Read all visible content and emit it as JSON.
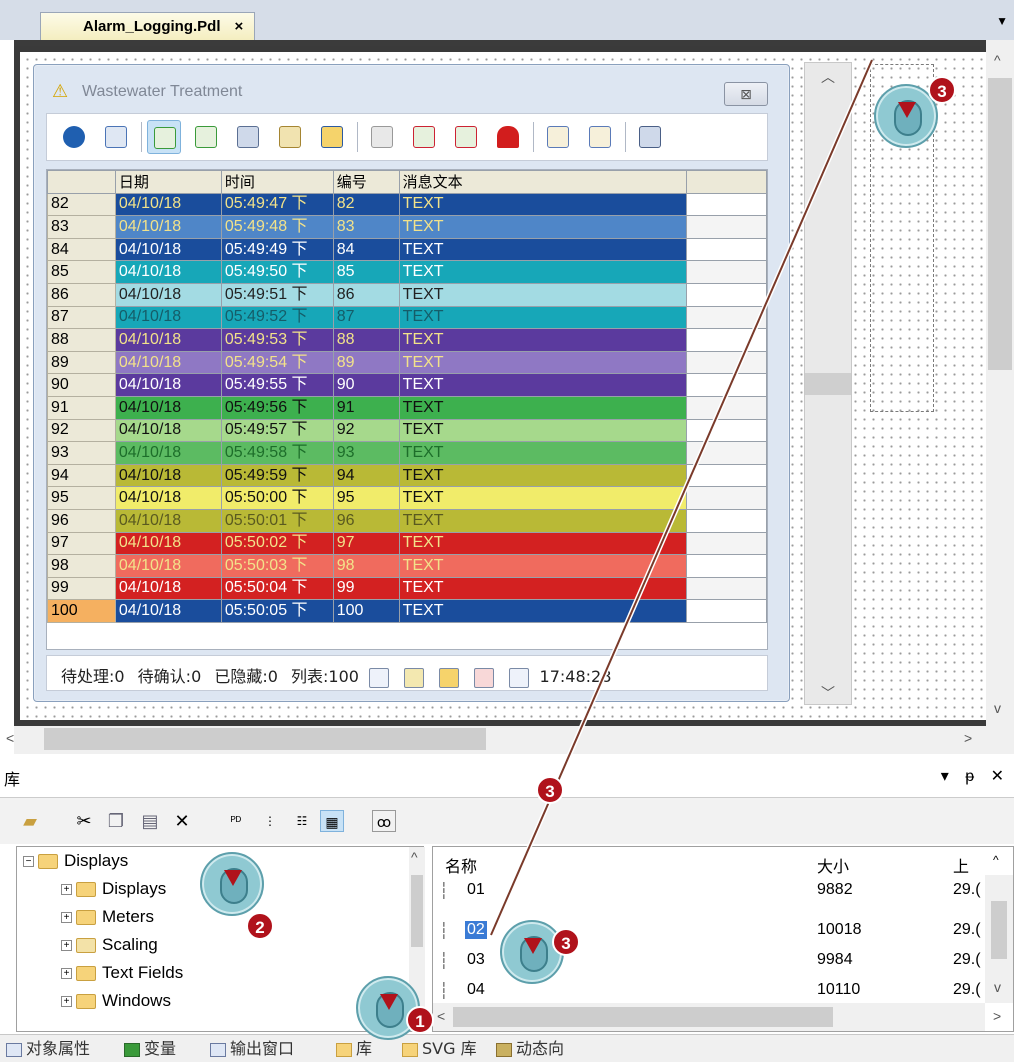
{
  "document_tab": {
    "title": "Alarm_Logging.Pdl",
    "close": "×",
    "menu": "▼"
  },
  "alarm_window": {
    "title": "Wastewater Treatment",
    "close_button": "⊠",
    "columns": [
      "",
      "日期",
      "时间",
      "编号",
      "消息文本",
      ""
    ],
    "rows": [
      {
        "n": "82",
        "date": "04/10/18",
        "time": "05:49:47 下",
        "id": "82",
        "text": "TEXT",
        "bg": "#1a4d9c",
        "fg": "#f2e28a"
      },
      {
        "n": "83",
        "date": "04/10/18",
        "time": "05:49:48 下",
        "id": "83",
        "text": "TEXT",
        "bg": "#4f86c8",
        "fg": "#f2e28a"
      },
      {
        "n": "84",
        "date": "04/10/18",
        "time": "05:49:49 下",
        "id": "84",
        "text": "TEXT",
        "bg": "#1a4d9c",
        "fg": "#ffffff"
      },
      {
        "n": "85",
        "date": "04/10/18",
        "time": "05:49:50 下",
        "id": "85",
        "text": "TEXT",
        "bg": "#17a7b8",
        "fg": "#ffffff"
      },
      {
        "n": "86",
        "date": "04/10/18",
        "time": "05:49:51 下",
        "id": "86",
        "text": "TEXT",
        "bg": "#a3dbe3",
        "fg": "#222222"
      },
      {
        "n": "87",
        "date": "04/10/18",
        "time": "05:49:52 下",
        "id": "87",
        "text": "TEXT",
        "bg": "#17a7b8",
        "fg": "#155d69"
      },
      {
        "n": "88",
        "date": "04/10/18",
        "time": "05:49:53 下",
        "id": "88",
        "text": "TEXT",
        "bg": "#5b3a9e",
        "fg": "#f2e28a"
      },
      {
        "n": "89",
        "date": "04/10/18",
        "time": "05:49:54 下",
        "id": "89",
        "text": "TEXT",
        "bg": "#8f78c4",
        "fg": "#f2e28a"
      },
      {
        "n": "90",
        "date": "04/10/18",
        "time": "05:49:55 下",
        "id": "90",
        "text": "TEXT",
        "bg": "#5b3a9e",
        "fg": "#ffffff"
      },
      {
        "n": "91",
        "date": "04/10/18",
        "time": "05:49:56 下",
        "id": "91",
        "text": "TEXT",
        "bg": "#3db04e",
        "fg": "#111111"
      },
      {
        "n": "92",
        "date": "04/10/18",
        "time": "05:49:57 下",
        "id": "92",
        "text": "TEXT",
        "bg": "#a6d98c",
        "fg": "#111111"
      },
      {
        "n": "93",
        "date": "04/10/18",
        "time": "05:49:58 下",
        "id": "93",
        "text": "TEXT",
        "bg": "#5cbb62",
        "fg": "#1d6e2a"
      },
      {
        "n": "94",
        "date": "04/10/18",
        "time": "05:49:59 下",
        "id": "94",
        "text": "TEXT",
        "bg": "#b9b936",
        "fg": "#111111"
      },
      {
        "n": "95",
        "date": "04/10/18",
        "time": "05:50:00 下",
        "id": "95",
        "text": "TEXT",
        "bg": "#f1ec6a",
        "fg": "#111111"
      },
      {
        "n": "96",
        "date": "04/10/18",
        "time": "05:50:01 下",
        "id": "96",
        "text": "TEXT",
        "bg": "#b9b936",
        "fg": "#5a5a20"
      },
      {
        "n": "97",
        "date": "04/10/18",
        "time": "05:50:02 下",
        "id": "97",
        "text": "TEXT",
        "bg": "#d32121",
        "fg": "#f2e28a"
      },
      {
        "n": "98",
        "date": "04/10/18",
        "time": "05:50:03 下",
        "id": "98",
        "text": "TEXT",
        "bg": "#f06b5e",
        "fg": "#f2e28a"
      },
      {
        "n": "99",
        "date": "04/10/18",
        "time": "05:50:04 下",
        "id": "99",
        "text": "TEXT",
        "bg": "#d32121",
        "fg": "#ffffff"
      },
      {
        "n": "100",
        "date": "04/10/18",
        "time": "05:50:05 下",
        "id": "100",
        "text": "TEXT",
        "bg": "#1a4d9c",
        "fg": "#ffffff"
      }
    ],
    "status": {
      "pending": "待处理:0",
      "to_ack": "待确认:0",
      "hidden": "已隐藏:0",
      "list": "列表:100",
      "clock": "17:48:28"
    }
  },
  "library": {
    "title": "库",
    "controls": "▾ ᵽ ✕",
    "tree": [
      {
        "label": "Displays",
        "level": 0,
        "expand": "−"
      },
      {
        "label": "Displays",
        "level": 1,
        "expand": "+"
      },
      {
        "label": "Meters",
        "level": 1,
        "expand": "+"
      },
      {
        "label": "Scaling",
        "level": 1,
        "expand": "+"
      },
      {
        "label": "Text Fields",
        "level": 1,
        "expand": "+"
      },
      {
        "label": "Windows",
        "level": 1,
        "expand": "+"
      }
    ],
    "file_columns": {
      "name": "名称",
      "size": "大小",
      "date": "上"
    },
    "files": [
      {
        "name": "01",
        "size": "9882",
        "date": "29.("
      },
      {
        "name": "02",
        "size": "10018",
        "date": "29.("
      },
      {
        "name": "03",
        "size": "9984",
        "date": "29.("
      },
      {
        "name": "04",
        "size": "10110",
        "date": "29.("
      }
    ]
  },
  "bottom_tabs": [
    "对象属性",
    "变量",
    "输出窗口",
    "库",
    "SVG 库",
    "动态向"
  ],
  "callouts": {
    "step1": "1",
    "step2": "2",
    "step3": "3"
  }
}
